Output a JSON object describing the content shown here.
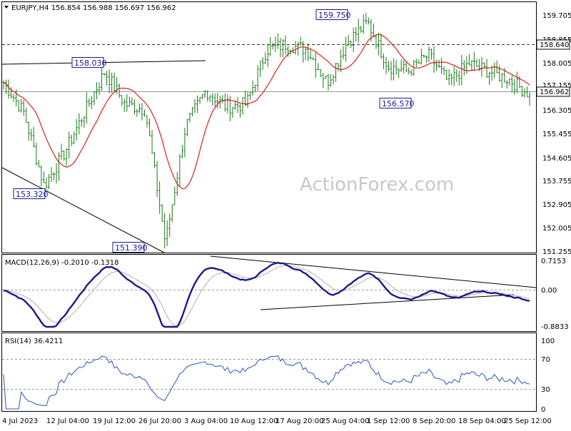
{
  "chart": {
    "symbol_header": "EURJPY,H4  156.854 156.988 156.697 156.962",
    "watermark": "ActionForex.com",
    "current_price_label": "156.962",
    "hline_label": "158.640",
    "colors": {
      "candle": "#1a7a1a",
      "ma": "#d82020",
      "macd_main": "#1a1a8c",
      "macd_signal": "#b0b0b0",
      "rsi": "#3050c0",
      "trendline": "#000000",
      "grid": "#999999",
      "annotation_box": "#1a1a8c"
    },
    "price_axis": [
      "159.705",
      "158.855",
      "158.005",
      "157.155",
      "156.305",
      "155.455",
      "154.605",
      "153.755",
      "152.905",
      "152.005",
      "151.255"
    ],
    "time_axis": [
      "4 Jul 2023",
      "12 Jul 04:00",
      "19 Jul 12:00",
      "26 Jul 20:00",
      "3 Aug 04:00",
      "10 Aug 12:00",
      "17 Aug 20:00",
      "25 Aug 04:00",
      "1 Sep 12:00",
      "8 Sep 20:00",
      "18 Sep 04:00",
      "25 Sep 12:00"
    ],
    "annotations": [
      "159.750",
      "158.030",
      "153.320",
      "151.390",
      "156.570"
    ]
  },
  "macd": {
    "header": "MACD(12,26,9) -0.2010 -0.1318",
    "axis": [
      "0.7153",
      "0.00",
      "-0.8833"
    ]
  },
  "rsi": {
    "header": "RSI(14) 36.4211",
    "axis": [
      "100",
      "70",
      "30",
      "0"
    ]
  },
  "chart_data": {
    "type": "candlestick",
    "title": "EURJPY,H4",
    "ylim": [
      151.255,
      159.9
    ],
    "close_points": [
      {
        "x": "4 Jul 2023",
        "y": 157.4
      },
      {
        "x": "8 Jul",
        "y": 156.3
      },
      {
        "x": "11 Jul",
        "y": 153.6
      },
      {
        "x": "13 Jul",
        "y": 154.8
      },
      {
        "x": "17 Jul",
        "y": 156.3
      },
      {
        "x": "19 Jul 12:00",
        "y": 157.8
      },
      {
        "x": "21 Jul",
        "y": 156.6
      },
      {
        "x": "24 Jul",
        "y": 156.4
      },
      {
        "x": "27 Jul",
        "y": 151.5
      },
      {
        "x": "28 Jul",
        "y": 155.8
      },
      {
        "x": "1 Aug",
        "y": 157.1
      },
      {
        "x": "3 Aug 04:00",
        "y": 156.5
      },
      {
        "x": "7 Aug",
        "y": 156.6
      },
      {
        "x": "10 Aug 12:00",
        "y": 158.6
      },
      {
        "x": "14 Aug",
        "y": 158.8
      },
      {
        "x": "17 Aug 20:00",
        "y": 158.6
      },
      {
        "x": "22 Aug",
        "y": 157.4
      },
      {
        "x": "25 Aug 04:00",
        "y": 158.9
      },
      {
        "x": "29 Aug",
        "y": 159.6
      },
      {
        "x": "1 Sep 12:00",
        "y": 158.0
      },
      {
        "x": "5 Sep",
        "y": 157.8
      },
      {
        "x": "8 Sep 20:00",
        "y": 158.4
      },
      {
        "x": "12 Sep",
        "y": 157.4
      },
      {
        "x": "18 Sep 04:00",
        "y": 158.1
      },
      {
        "x": "21 Sep",
        "y": 157.8
      },
      {
        "x": "25 Sep 12:00",
        "y": 157.5
      },
      {
        "x": "27 Sep",
        "y": 156.962
      }
    ],
    "levels": {
      "resistance": 158.64,
      "current": 156.962
    },
    "macd_header_values": {
      "macd": -0.201,
      "signal": -0.1318
    },
    "rsi_value": 36.4211
  }
}
